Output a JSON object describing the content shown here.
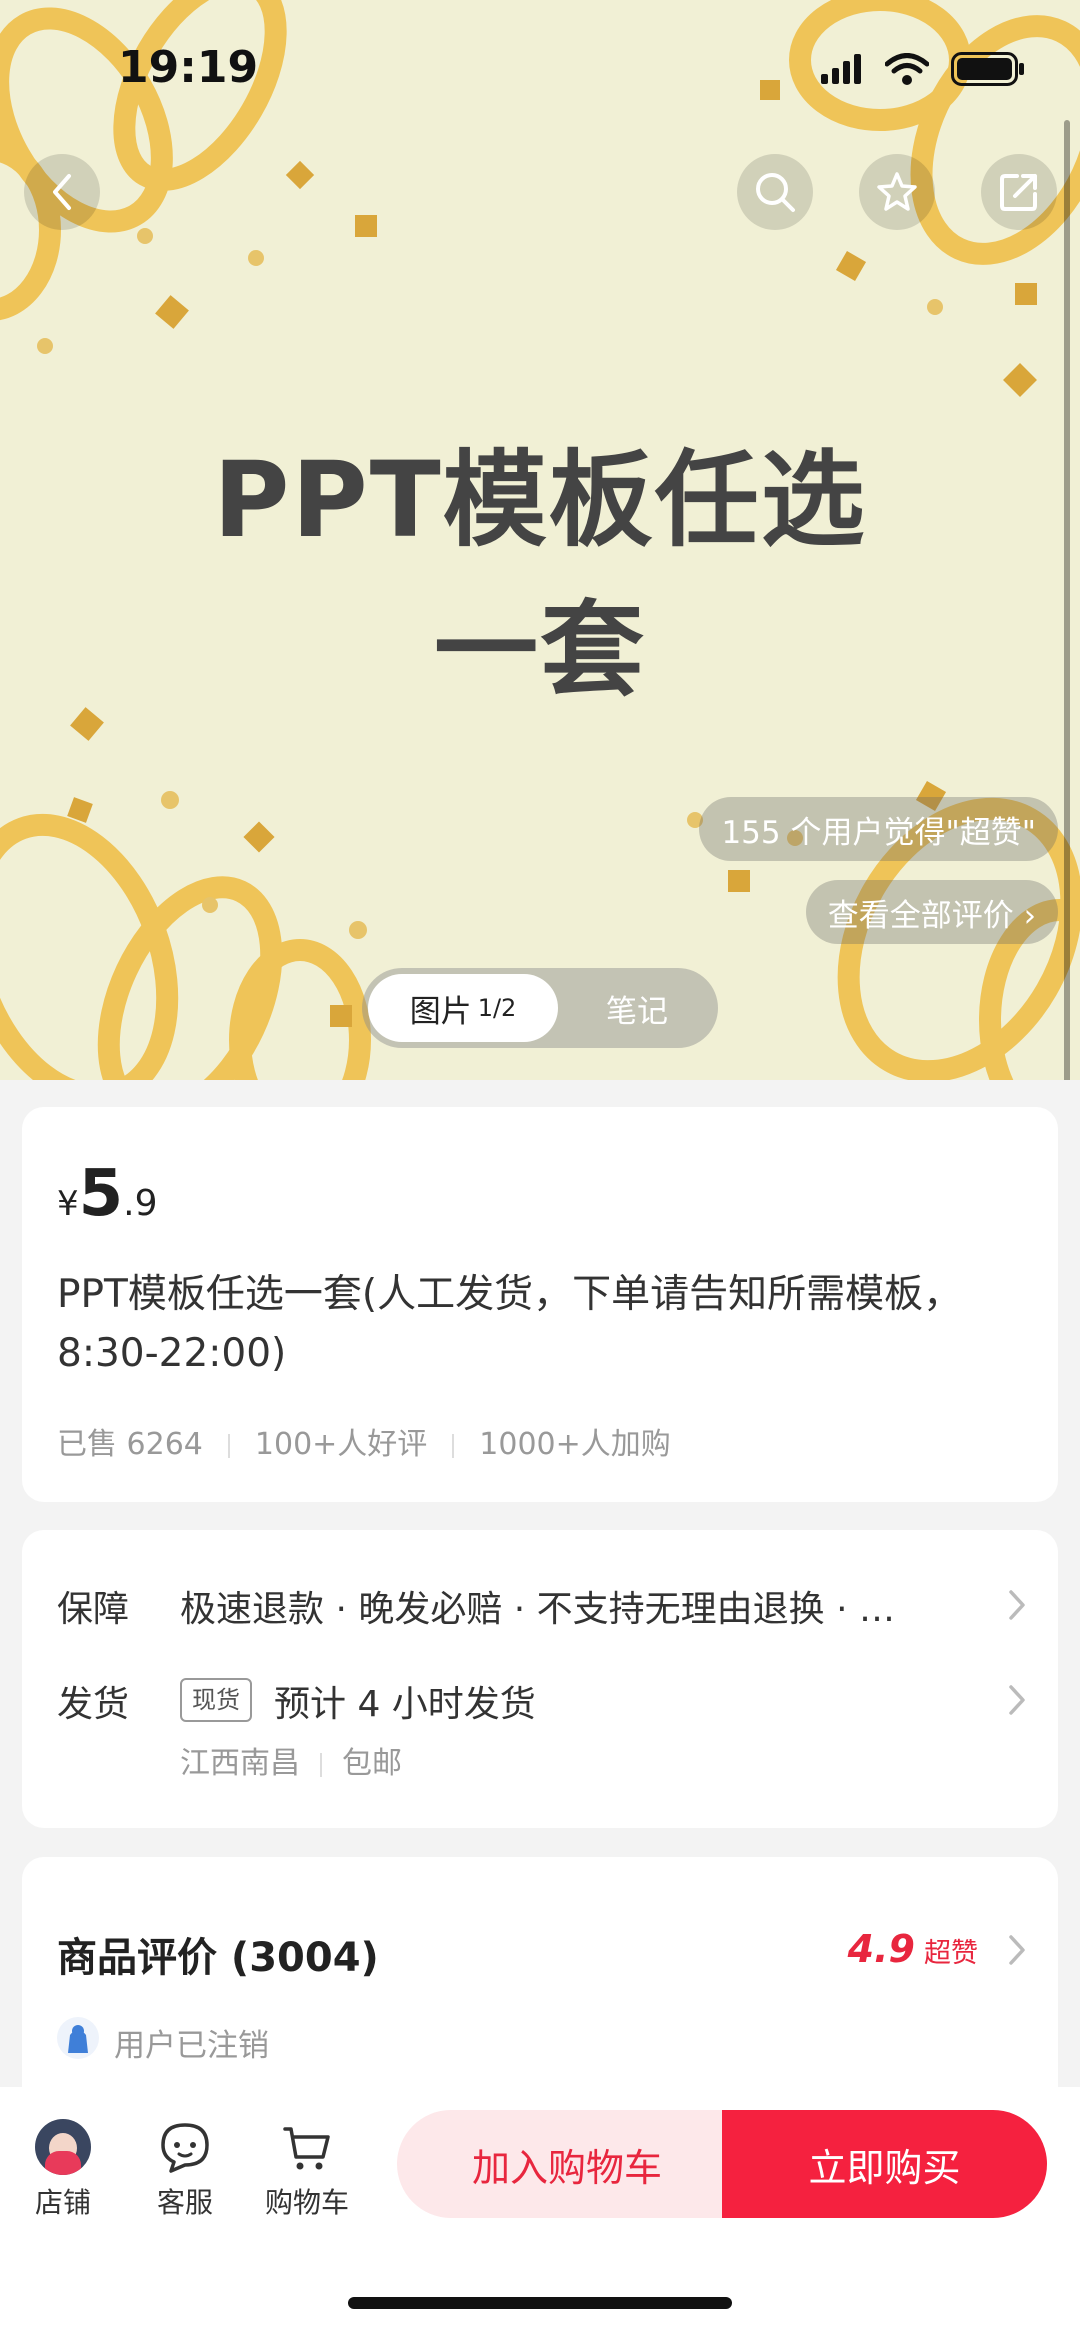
{
  "status_bar": {
    "time": "19:19"
  },
  "hero": {
    "title_line1": "PPT模板任选",
    "title_line2": "一套",
    "likes_text": "155 个用户觉得\"超赞\"",
    "reviews_link": "查看全部评价 ›",
    "media_tabs": {
      "active_label": "图片",
      "active_count": "1/2",
      "inactive_label": "笔记"
    }
  },
  "product": {
    "currency": "¥",
    "price_int": "5",
    "price_dec": ".9",
    "title": "PPT模板任选一套(人工发货，下单请告知所需模板，8:30-22:00)",
    "sold": "已售 6264",
    "good_reviews": "100+人好评",
    "added_to_cart": "1000+人加购"
  },
  "service": {
    "guarantee_label": "保障",
    "guarantee_text": "极速退款 · 晚发必赔 · 不支持无理由退换 · …",
    "shipping_label": "发货",
    "stock_badge": "现货",
    "shipping_eta": "预计 4 小时发货",
    "origin": "江西南昌",
    "shipping_fee": "包邮"
  },
  "reviews": {
    "title": "商品评价 (3004)",
    "score": "4.9",
    "score_label": "超赞",
    "first_user": "用户已注销"
  },
  "bottom_bar": {
    "store_label": "店铺",
    "service_label": "客服",
    "cart_label": "购物车",
    "add_to_cart": "加入购物车",
    "buy_now": "立即购买"
  },
  "colors": {
    "accent": "#f5213f",
    "accent_light": "#fde8ea",
    "hero_bg": "#f1f0d5",
    "ribbon": "#efc458"
  }
}
